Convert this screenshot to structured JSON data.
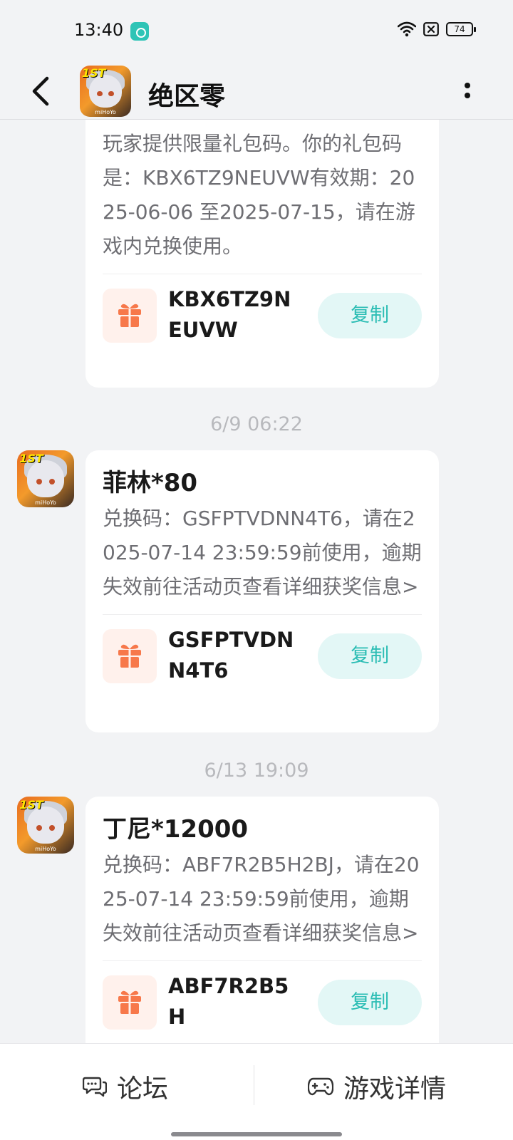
{
  "status_bar": {
    "time": "13:40",
    "battery": "74"
  },
  "header": {
    "title": "绝区零"
  },
  "avatar": {
    "badge": "1ST",
    "brand": "miHoYo"
  },
  "messages": [
    {
      "title": "",
      "body": "玩家提供限量礼包码。你的礼包码是：KBX6TZ9NEUVW有效期：2025-06-06 至2025-07-15，请在游戏内兑换使用。",
      "code": "KBX6TZ9NEUVW",
      "copy_label": "复制"
    },
    {
      "timestamp": "6/9  06:22",
      "title": "菲林*80",
      "body": "兑换码：GSFPTVDNN4T6，请在2025-07-14 23:59:59前使用，逾期失效前往活动页查看详细获奖信息>",
      "code": "GSFPTVDNN4T6",
      "copy_label": "复制"
    },
    {
      "timestamp": "6/13  19:09",
      "title": "丁尼*12000",
      "body": "兑换码：ABF7R2B5H2BJ，请在2025-07-14 23:59:59前使用，逾期失效前往活动页查看详细获奖信息>",
      "code": "ABF7R2B5H",
      "copy_label": "复制"
    }
  ],
  "bottom_bar": {
    "forum_label": "论坛",
    "detail_label": "游戏详情"
  },
  "colors": {
    "accent": "#2bbdb4",
    "copy_bg": "#e3f7f6",
    "gift": "#f7784a",
    "gift_bg": "#fff1ec",
    "page_bg": "#f2f3f5"
  }
}
